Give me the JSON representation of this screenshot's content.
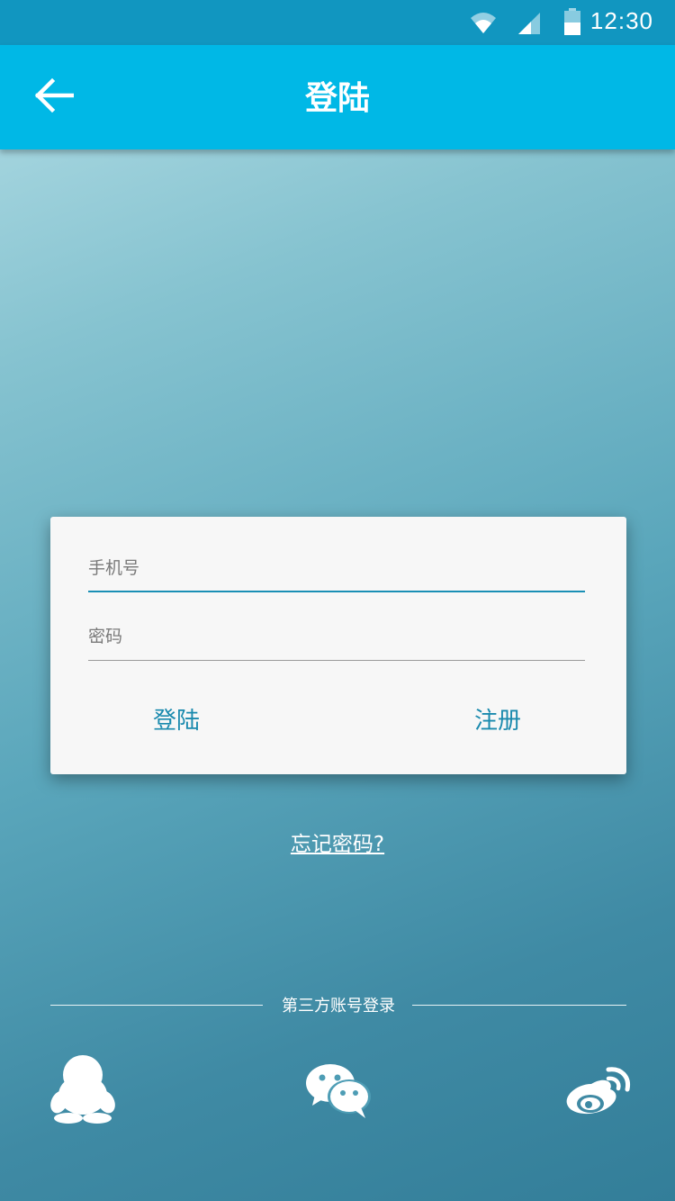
{
  "status_bar": {
    "time": "12:30",
    "icons": [
      "wifi-icon",
      "signal-icon",
      "battery-icon"
    ]
  },
  "header": {
    "title": "登陆",
    "back_icon": "arrow-left-icon"
  },
  "login_form": {
    "phone_placeholder": "手机号",
    "phone_value": "",
    "password_placeholder": "密码",
    "password_value": "",
    "login_label": "登陆",
    "register_label": "注册"
  },
  "forgot_password": "忘记密码?",
  "third_party": {
    "title": "第三方账号登录",
    "providers": [
      "qq-icon",
      "wechat-icon",
      "weibo-icon"
    ]
  },
  "colors": {
    "status_bar": "#1196c0",
    "app_bar": "#00b8e6",
    "accent": "#1a8aae",
    "card": "#f7f7f7"
  }
}
